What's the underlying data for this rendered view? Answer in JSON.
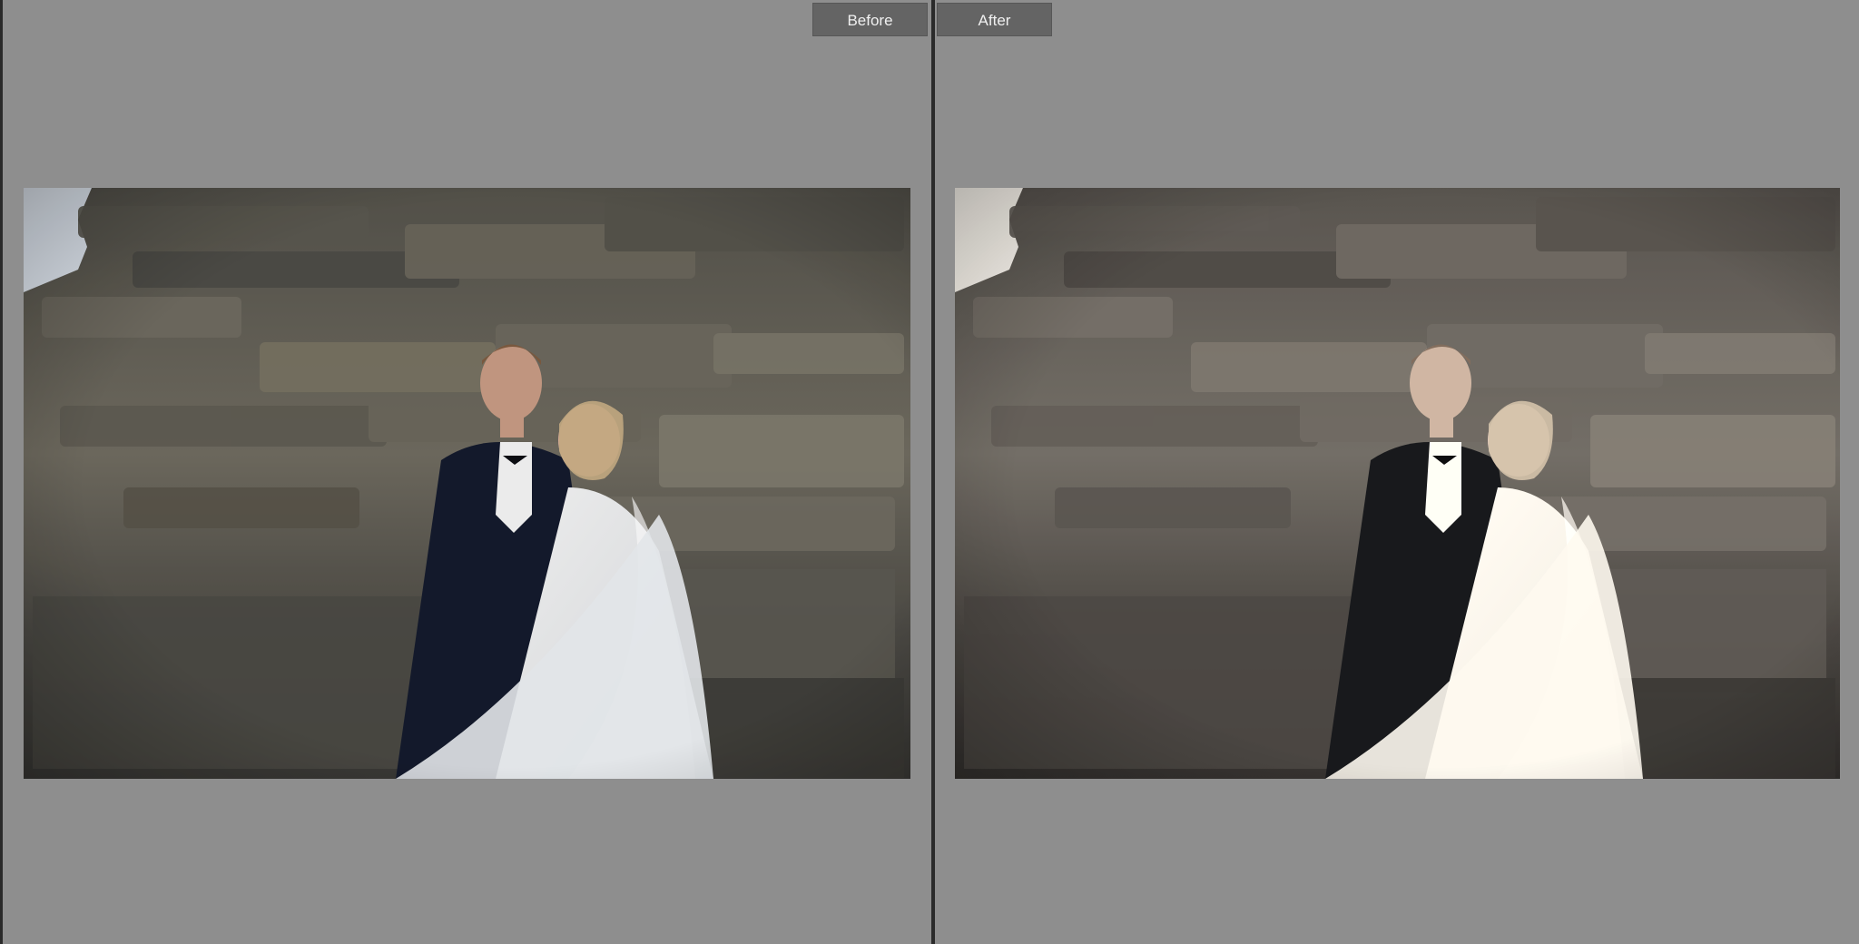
{
  "compare": {
    "before_label": "Before",
    "after_label": "After"
  },
  "photo": {
    "subject": "wedding-couple-by-rock-wall",
    "before_palette": {
      "sky": "#e8eef6",
      "rock_light": "#7c786c",
      "rock_mid": "#5f5c52",
      "rock_dark": "#34332f",
      "suit": "#14192a",
      "dress": "#eceef0"
    },
    "after_palette": {
      "sky": "#f3f3f3",
      "rock_light": "#7f776f",
      "rock_mid": "#5e5852",
      "rock_dark": "#302c2a",
      "suit": "#151820",
      "dress": "#f2f0ee"
    }
  }
}
